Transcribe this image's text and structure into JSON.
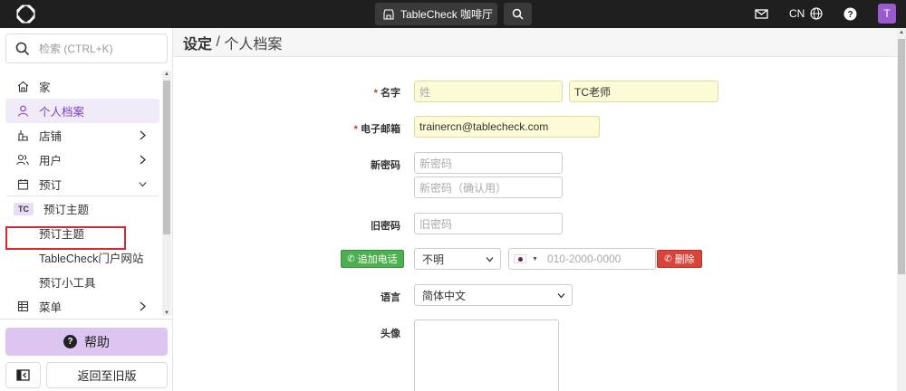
{
  "topbar": {
    "venue_label": "TableCheck 咖啡厅",
    "language": "CN",
    "avatar_initial": "T"
  },
  "sidebar": {
    "search_placeholder": "检索 (CTRL+K)",
    "items": [
      {
        "label": "家",
        "icon": "home-icon"
      },
      {
        "label": "个人档案",
        "icon": "user-icon"
      },
      {
        "label": "店铺",
        "icon": "store-icon"
      },
      {
        "label": "用户",
        "icon": "users-icon"
      },
      {
        "label": "预订",
        "icon": "calendar-icon"
      },
      {
        "label": "预订主题",
        "badge": "TC"
      },
      {
        "label": "预订主题"
      },
      {
        "label": "TableCheck门户网站"
      },
      {
        "label": "预订小工具"
      },
      {
        "label": "菜单",
        "icon": "menu-icon"
      }
    ],
    "help_label": "帮助",
    "old_version_label": "返回至旧版"
  },
  "page": {
    "breadcrumb_section": "设定",
    "breadcrumb_sep": " / ",
    "breadcrumb_page": "个人档案"
  },
  "form": {
    "name_label": "名字",
    "last_name_placeholder": "姓",
    "first_name_value": "TC老师",
    "email_label": "电子邮箱",
    "email_value": "trainercn@tablecheck.com",
    "new_password_label": "新密码",
    "new_password_placeholder": "新密码",
    "confirm_password_placeholder": "新密码（确认用）",
    "old_password_label": "旧密码",
    "old_password_placeholder": "旧密码",
    "add_phone_label": "追加电话",
    "phone_type_value": "不明",
    "phone_placeholder": "010-2000-0000",
    "delete_label": "删除",
    "language_label": "语言",
    "language_value": "简体中文",
    "avatar_label": "头像"
  },
  "colors": {
    "topbar": "#1f1f1f",
    "accent": "#7a3fbf",
    "required": "#c0392b",
    "add_button": "#4caf50",
    "delete_button": "#d9443a",
    "highlight_box": "#d9272e"
  }
}
